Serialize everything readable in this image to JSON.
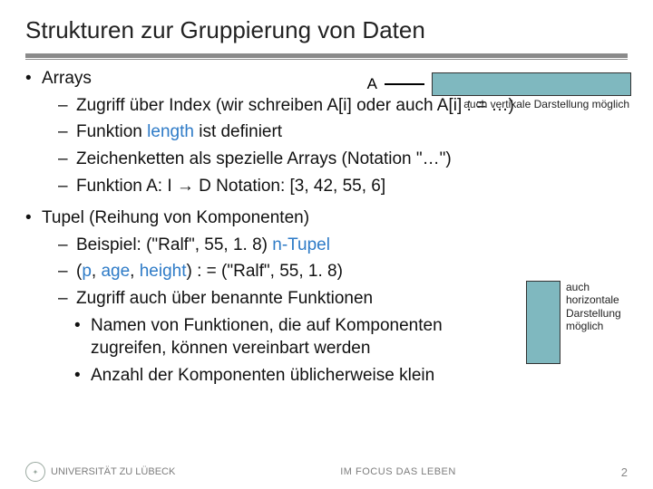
{
  "title": "Strukturen zur Gruppierung von Daten",
  "arrayHeader": "Arrays",
  "aLabel": "A",
  "aNote": "auch vertikale Darstellung möglich",
  "arrayItems": {
    "i0": "Zugriff über Index (wir schreiben A[i] oder auch A[i] : = …)",
    "i1_pre": "Funktion ",
    "i1_kw": "length",
    "i1_post": " ist definiert",
    "i2": "Zeichenketten als spezielle Arrays (Notation \"…\")",
    "i3_pre": "Funktion A: I ",
    "i3_arrow": "→",
    "i3_mid": " D   Notation: [3, 42, 55, 6]"
  },
  "tupleHeader": "Tupel (Reihung von Komponenten)",
  "sideNote": "auch horizontale Darstellung möglich",
  "tupleItems": {
    "t0_pre": "Beispiel: (\"Ralf\", 55, 1. 8)      ",
    "t0_kw": "n-Tupel",
    "t1_pre": "(",
    "t1_p": "p",
    "t1_sep1": ", ",
    "t1_age": "age",
    "t1_sep2": ", ",
    "t1_height": "height",
    "t1_post": ") : = (\"Ralf\", 55, 1. 8)",
    "t2": "Zugriff auch über benannte Funktionen",
    "s0": "Namen von Funktionen, die auf Komponenten zugreifen, können vereinbart werden",
    "s1": "Anzahl der Komponenten üblicherweise klein"
  },
  "footer": {
    "uni": "UNIVERSITÄT ZU LÜBECK",
    "center": "IM FOCUS DAS LEBEN",
    "page": "2"
  }
}
